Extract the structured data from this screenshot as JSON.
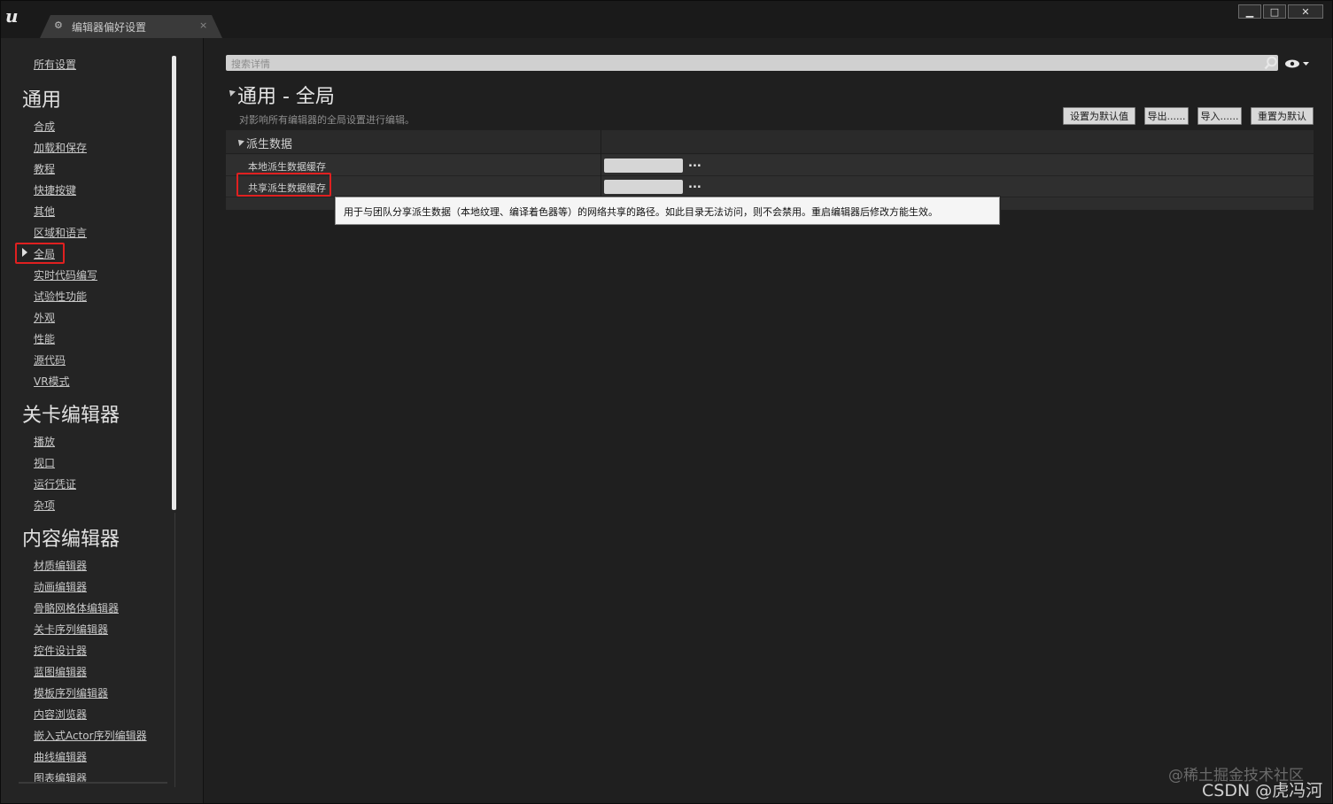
{
  "window": {
    "tab_title": "编辑器偏好设置",
    "tab_close": "×",
    "controls": {
      "minimize": "▁",
      "maximize": "□",
      "close": "✕"
    },
    "logo": "u"
  },
  "nav": {
    "all_settings": "所有设置",
    "sections": [
      {
        "header": "通用",
        "items": [
          "合成",
          "加载和保存",
          "教程",
          "快捷按键",
          "其他",
          "区域和语言",
          "全局",
          "实时代码编写",
          "试验性功能",
          "外观",
          "性能",
          "源代码",
          "VR模式"
        ]
      },
      {
        "header": "关卡编辑器",
        "items": [
          "播放",
          "视口",
          "运行凭证",
          "杂项"
        ]
      },
      {
        "header": "内容编辑器",
        "items": [
          "材质编辑器",
          "动画编辑器",
          "骨骼网格体编辑器",
          "关卡序列编辑器",
          "控件设计器",
          "蓝图编辑器",
          "模板序列编辑器",
          "内容浏览器",
          "嵌入式Actor序列编辑器",
          "曲线编辑器",
          "图表编辑器"
        ]
      }
    ],
    "selected": "全局"
  },
  "main": {
    "search_placeholder": "搜索详情",
    "title": "通用 - 全局",
    "description": "对影响所有编辑器的全局设置进行编辑。",
    "buttons": {
      "set_default": "设置为默认值",
      "export": "导出......",
      "import": "导入......",
      "reset": "重置为默认"
    },
    "category": "派生数据",
    "properties": [
      {
        "label": "本地派生数据缓存",
        "value": "",
        "browse": "..."
      },
      {
        "label": "共享派生数据缓存",
        "value": "",
        "browse": "..."
      }
    ],
    "tooltip": "用于与团队分享派生数据（本地纹理、编译着色器等）的网络共享的路径。如此目录无法访问，则不会禁用。重启编辑器后修改方能生效。"
  },
  "watermark": {
    "line1": "@稀土掘金技术社区",
    "line2": "CSDN @虎冯河"
  },
  "colors": {
    "highlight": "#e02020",
    "background": "#242424"
  }
}
